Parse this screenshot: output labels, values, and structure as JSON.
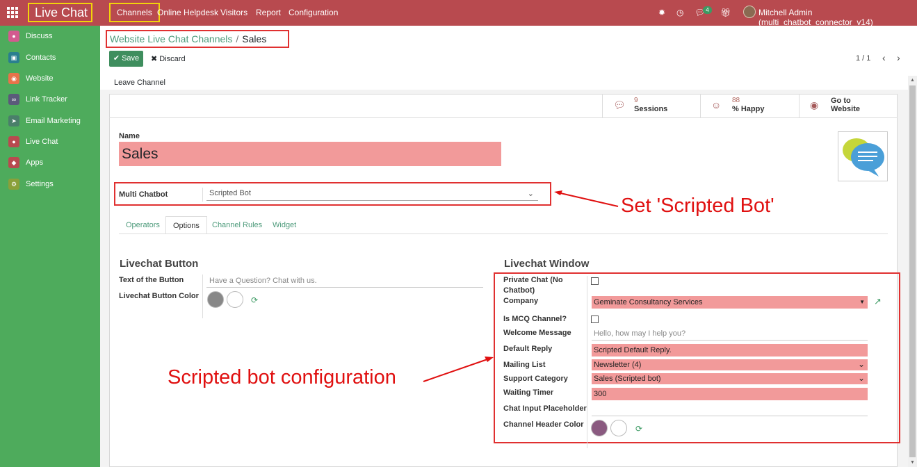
{
  "topbar": {
    "app_title": "Live Chat",
    "menus": [
      "Channels",
      "Online Helpdesk",
      "Visitors",
      "Report",
      "Configuration"
    ],
    "chat_badge": "4",
    "user": "Mitchell Admin (multi_chatbot_connector_v14)"
  },
  "sidebar": {
    "items": [
      {
        "label": "Discuss",
        "color": "#d35a8f",
        "icon": "discuss-icon"
      },
      {
        "label": "Contacts",
        "color": "#2a7f8f",
        "icon": "contacts-icon"
      },
      {
        "label": "Website",
        "color": "#e8734a",
        "icon": "website-icon"
      },
      {
        "label": "Link Tracker",
        "color": "#5a5a7a",
        "icon": "link-tracker-icon"
      },
      {
        "label": "Email Marketing",
        "color": "#4a7f6a",
        "icon": "email-marketing-icon"
      },
      {
        "label": "Live Chat",
        "color": "#b84a4f",
        "icon": "live-chat-icon"
      },
      {
        "label": "Apps",
        "color": "#b84a4f",
        "icon": "apps-icon"
      },
      {
        "label": "Settings",
        "color": "#8aa03a",
        "icon": "settings-icon"
      }
    ]
  },
  "breadcrumb": {
    "parent": "Website Live Chat Channels",
    "sep": "/",
    "current": "Sales"
  },
  "actions": {
    "save": "Save",
    "discard": "Discard",
    "pager": "1 / 1",
    "leave": "Leave Channel"
  },
  "stats": {
    "sessions_num": "9",
    "sessions_lbl": "Sessions",
    "happy_num": "88",
    "happy_lbl": "% Happy",
    "goto_1": "Go to",
    "goto_2": "Website"
  },
  "form": {
    "name_label": "Name",
    "name_value": "Sales",
    "multi_label": "Multi Chatbot",
    "multi_value": "Scripted Bot",
    "tabs": [
      "Operators",
      "Options",
      "Channel Rules",
      "Widget"
    ],
    "button_section": "Livechat Button",
    "text_button_label": "Text of the Button",
    "text_button_placeholder": "Have a Question? Chat with us.",
    "button_color_label": "Livechat Button Color",
    "window_section": "Livechat Window",
    "private_label_1": "Private Chat (No",
    "private_label_2": "Chatbot)",
    "company_label": "Company",
    "company_value": "Geminate Consultancy Services",
    "mcq_label": "Is MCQ Channel?",
    "welcome_label": "Welcome Message",
    "welcome_placeholder": "Hello, how may I help you?",
    "default_reply_label": "Default Reply",
    "default_reply_value": "Scripted Default Reply.",
    "mailing_label": "Mailing List",
    "mailing_value": "Newsletter (4)",
    "support_label": "Support Category",
    "support_value": "Sales (Scripted bot)",
    "timer_label": "Waiting Timer",
    "timer_value": "300",
    "placeholder_label": "Chat Input Placeholder",
    "header_color_label": "Channel Header Color"
  },
  "annotations": {
    "set_bot": "Set 'Scripted Bot'",
    "config": "Scripted bot configuration"
  },
  "colors": {
    "topbar": "#b84a4f",
    "sidebar": "#4eab5c",
    "highlight": "#f29a9a",
    "button_color": "#888888",
    "header_color": "#8a5a80"
  }
}
